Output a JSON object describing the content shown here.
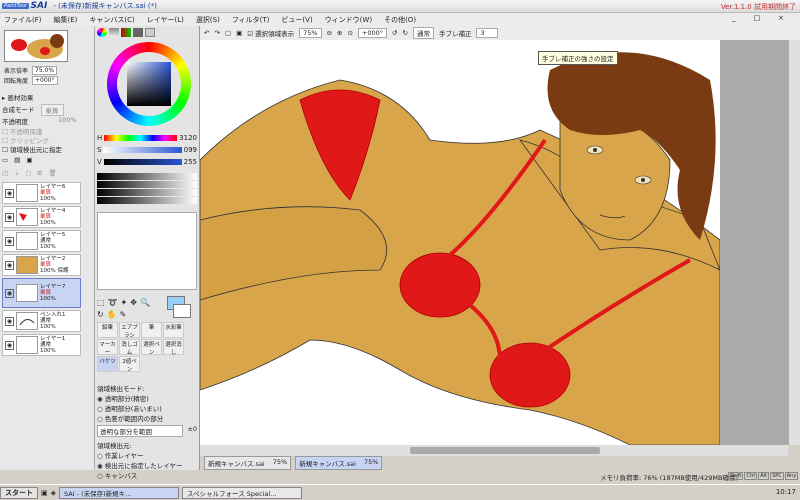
{
  "window": {
    "logo_small": "PaintTool",
    "logo_big": "SAI",
    "title": "- (未保存)新規キャンバス.sai (*)",
    "version": "Ver.1.1.0 試用期間終了"
  },
  "menu": [
    "ファイル(F)",
    "編集(E)",
    "キャンバス(C)",
    "レイヤー(L)",
    "選択(S)",
    "フィルタ(T)",
    "ビュー(V)",
    "ウィンドウ(W)",
    "その他(O)"
  ],
  "window_controls": [
    "_",
    "□",
    "×"
  ],
  "navigator": {
    "zoom_label": "表示倍率",
    "zoom_value": "75.0%",
    "angle_label": "回転角度",
    "angle_value": "+000°"
  },
  "layer_panel": {
    "paper_effect": "画材効果",
    "blend_mode_label": "合成モード",
    "blend_mode_value": "乗算",
    "opacity_label": "不透明度",
    "opacity_value": "100%",
    "protect_opacity": "不透明保護",
    "clip_group": "クリッピング",
    "selection_source": "領域検出元に指定",
    "layers": [
      {
        "name": "レイヤー6",
        "mode": "乗算",
        "opacity": "100%"
      },
      {
        "name": "レイヤー4",
        "mode": "乗算",
        "opacity": "100%"
      },
      {
        "name": "レイヤー5",
        "mode": "通常",
        "opacity": "100%"
      },
      {
        "name": "レイヤー2",
        "mode": "乗算",
        "opacity": "100% 保護"
      },
      {
        "name": "レイヤー7",
        "mode": "乗算",
        "opacity": "100%"
      },
      {
        "name": "ペン入れ1",
        "mode": "通常",
        "opacity": "100%"
      },
      {
        "name": "レイヤー1",
        "mode": "通常",
        "opacity": "100%"
      }
    ]
  },
  "color_panel": {
    "h_label": "H",
    "h_value": "3120",
    "s_label": "S",
    "s_value": "099",
    "v_label": "V",
    "v_value": "255"
  },
  "tools": {
    "items": [
      "鉛筆",
      "エアブラシ",
      "筆",
      "水彩筆",
      "マーカー",
      "消しゴム",
      "選択ペン",
      "選択消し",
      "バケツ",
      "2値ペン"
    ],
    "detect_mode_label": "領域検出モード:",
    "detect_modes": [
      "透明部分(精密)",
      "透明部分(あいまい)",
      "色差が範囲内の部分"
    ],
    "tolerance_label": "透明な部分を範囲",
    "tolerance_value": "±0",
    "detect_source_label": "領域検出元:",
    "detect_sources": [
      "作業レイヤー",
      "検出元に指定したレイヤー",
      "キャンバス"
    ]
  },
  "canvas_toolbar": {
    "show_selection": "選択領域表示",
    "zoom": "75%",
    "angle": "+000°",
    "mode": "通常",
    "stabilizer_label": "手ブレ補正",
    "stabilizer_value": "3"
  },
  "tooltip": "手ブレ補正の強さの設定",
  "tabs": [
    {
      "name": "新規キャンバス.sai",
      "zoom": "75%"
    },
    {
      "name": "新規キャンバス.sai",
      "zoom": "75%"
    }
  ],
  "status": {
    "memory": "メモリ負荷率: 76% (187MB使用/429MB確保)",
    "keys": [
      "Shift",
      "Ctrl",
      "Alt",
      "SPC",
      "Any"
    ]
  },
  "taskbar": {
    "start": "スタート",
    "tasks": [
      "SAI - (未保存)新規キ...",
      "スペシャルフォース Special..."
    ],
    "clock": "10:17"
  },
  "colors": {
    "skin": "#d9a54a",
    "bikini": "#e01818",
    "hair": "#7a3a12",
    "accent": "#3b6cc8"
  }
}
